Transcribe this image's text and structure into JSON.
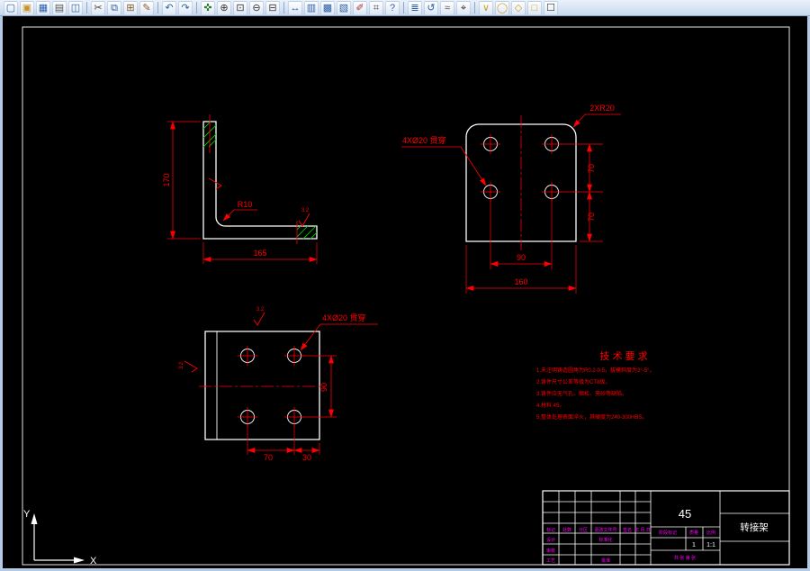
{
  "toolbar": {
    "icons": [
      {
        "name": "new-icon",
        "glyph": "▢",
        "color": "#2a5fa8"
      },
      {
        "name": "open-icon",
        "glyph": "▣",
        "color": "#c8922a"
      },
      {
        "name": "save-icon",
        "glyph": "▦",
        "color": "#2a5fa8"
      },
      {
        "name": "plot-icon",
        "glyph": "▤",
        "color": "#555555"
      },
      {
        "name": "preview-icon",
        "glyph": "◫",
        "color": "#2a5fa8"
      },
      {
        "sep": true
      },
      {
        "name": "cut-icon",
        "glyph": "✂",
        "color": "#444444"
      },
      {
        "name": "copy-icon",
        "glyph": "⧉",
        "color": "#2a5fa8"
      },
      {
        "name": "paste-icon",
        "glyph": "⊞",
        "color": "#7a5a2a"
      },
      {
        "name": "match-properties-icon",
        "glyph": "✎",
        "color": "#8a5a2a"
      },
      {
        "sep": true
      },
      {
        "name": "undo-icon",
        "glyph": "↶",
        "color": "#2a5fa8"
      },
      {
        "name": "redo-icon",
        "glyph": "↷",
        "color": "#2a5fa8"
      },
      {
        "sep": true
      },
      {
        "name": "pan-icon",
        "glyph": "✜",
        "color": "#2a7a2a"
      },
      {
        "name": "zoom-realtime-icon",
        "glyph": "⊕",
        "color": "#333333"
      },
      {
        "name": "zoom-window-icon",
        "glyph": "⊡",
        "color": "#333333"
      },
      {
        "name": "zoom-out-icon",
        "glyph": "⊖",
        "color": "#333333"
      },
      {
        "name": "zoom-previous-icon",
        "glyph": "⊟",
        "color": "#333333"
      },
      {
        "sep": true
      },
      {
        "name": "distance-icon",
        "glyph": "↔",
        "color": "#2a5fa8"
      },
      {
        "name": "properties-icon",
        "glyph": "▥",
        "color": "#2a5fa8"
      },
      {
        "name": "designcenter-icon",
        "glyph": "▩",
        "color": "#2a5fa8"
      },
      {
        "name": "tool-palettes-icon",
        "glyph": "▧",
        "color": "#2a5fa8"
      },
      {
        "name": "markup-icon",
        "glyph": "✐",
        "color": "#a03030"
      },
      {
        "name": "calculator-icon",
        "glyph": "⌗",
        "color": "#555555"
      },
      {
        "name": "help-icon",
        "glyph": "?",
        "color": "#2a5fa8"
      },
      {
        "sep": true
      },
      {
        "name": "layers-icon",
        "glyph": "≣",
        "color": "#2a5fa8"
      },
      {
        "name": "layer-previous-icon",
        "glyph": "↺",
        "color": "#2a5fa8"
      },
      {
        "name": "linetype-icon",
        "glyph": "≈",
        "color": "#555555"
      },
      {
        "name": "osnap-icon",
        "glyph": "⌖",
        "color": "#333333"
      },
      {
        "sep": true
      },
      {
        "name": "snap-marker-icon",
        "glyph": "∨",
        "color": "#caa02a"
      },
      {
        "name": "circle-marker-icon",
        "glyph": "◯",
        "color": "#caa02a"
      },
      {
        "name": "diamond-marker-icon",
        "glyph": "◇",
        "color": "#caa02a"
      },
      {
        "name": "square-marker-icon",
        "glyph": "□",
        "color": "#caa02a"
      },
      {
        "name": "checkbox-icon",
        "glyph": "☐",
        "color": "#333333"
      }
    ]
  },
  "views": {
    "side": {
      "dim_height": "170",
      "dim_width": "165",
      "radius_note": "R10",
      "finish": "3.2"
    },
    "top": {
      "hole_note": "4XØ20 贯穿",
      "corner_note": "2XR20",
      "dim_v1": "70",
      "dim_v2": "70",
      "dim_h1": "90",
      "dim_h2": "160"
    },
    "front": {
      "hole_note": "4XØ20 贯穿",
      "dim_v": "90",
      "dim_h1": "70",
      "dim_h2": "30",
      "finish_top": "3.2",
      "finish_left": "3.2"
    }
  },
  "tech": {
    "title": "技 术 要 求",
    "lines": [
      "1.未注明铸造圆角为R0.2-0.5，拔模斜度为3°-5°。",
      "2.铸件尺寸公差等级为CT8级。",
      "3.铸件应无气孔、缩松、夹砂等缺陷。",
      "4.材料:45。",
      "5.整体处理表面淬火，其硬度为240-300HBS。"
    ]
  },
  "title_block": {
    "material": "45",
    "part_name": "转接架",
    "header": [
      "标记",
      "处数",
      "分区",
      "更改文件号",
      "签名",
      "年.月.日"
    ],
    "roles": [
      "设计",
      "审核",
      "工艺"
    ],
    "role2_top": "标准化",
    "role2_bottom": "批准",
    "stage_label": "阶段标记",
    "mass_label": "质量",
    "scale_label": "比例",
    "mass_value": "1",
    "scale_value": "1:1",
    "sheet_note": "共 张 第 张"
  },
  "ucs": {
    "x_label": "X",
    "y_label": "Y"
  },
  "colors": {
    "canvas": "#000000",
    "outline": "#ffffff",
    "dimension": "#ff0000",
    "hatch": "#00c000",
    "title_block_text": "#ff00ff",
    "window_frame": "#b3c9e6"
  }
}
